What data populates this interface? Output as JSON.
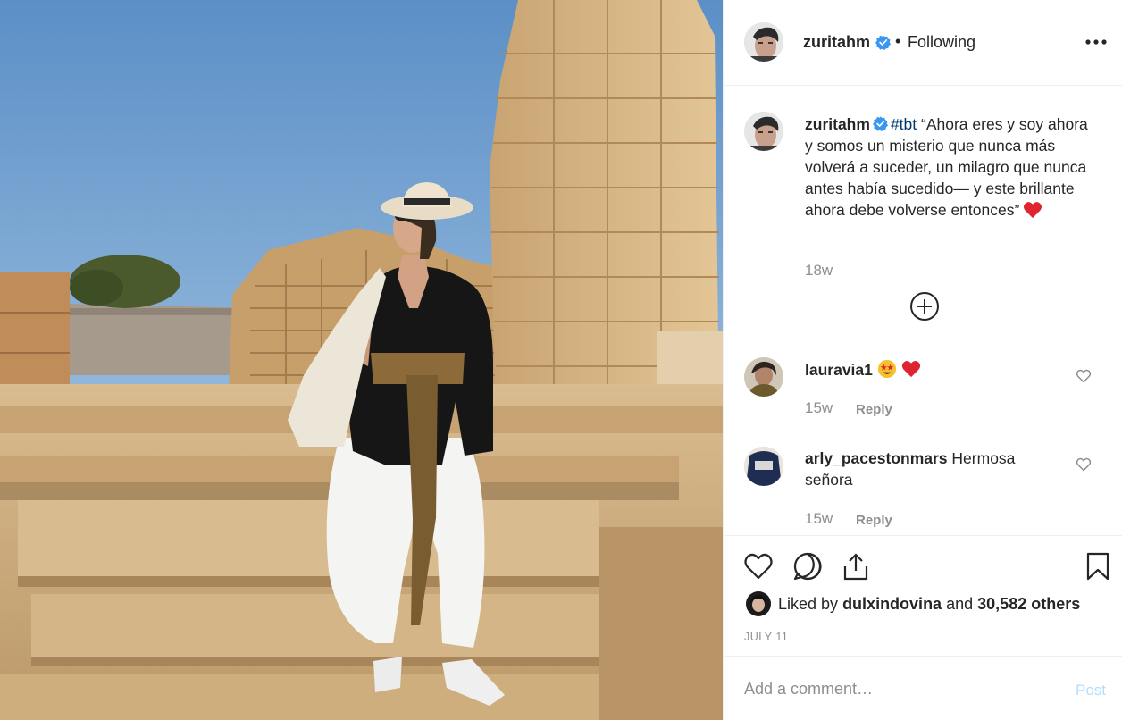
{
  "photo": {
    "description_icon": "post-photo"
  },
  "header": {
    "username": "zuritahm",
    "separator": "•",
    "follow_status": "Following",
    "verified_icon": "verified-badge-icon",
    "more_icon": "more-options-icon"
  },
  "caption": {
    "username": "zuritahm",
    "hashtag": "#tbt",
    "text": "“Ahora eres y soy ahora y somos un misterio que nunca más volverá a suceder, un milagro que nunca antes había sucedido— y este brillante ahora debe volverse entonces”",
    "time": "18w"
  },
  "comments": [
    {
      "username": "lauravia1",
      "text": "",
      "emojis": [
        "star-struck-emoji",
        "red-heart-emoji"
      ],
      "time": "15w",
      "reply_label": "Reply"
    },
    {
      "username": "arly_pacestonmars",
      "text": "Hermosa señora",
      "time": "15w",
      "reply_label": "Reply"
    }
  ],
  "likes": {
    "prefix": "Liked by",
    "user": "dulxindovina",
    "joiner": "and",
    "count": "30,582 others"
  },
  "date": "JULY 11",
  "add_comment": {
    "placeholder": "Add a comment…",
    "post_label": "Post"
  },
  "colors": {
    "link": "#00376b",
    "verified": "#3897f0",
    "muted": "#8e8e8e",
    "post_disabled": "#b2dffc",
    "heart": "#ed4956"
  }
}
